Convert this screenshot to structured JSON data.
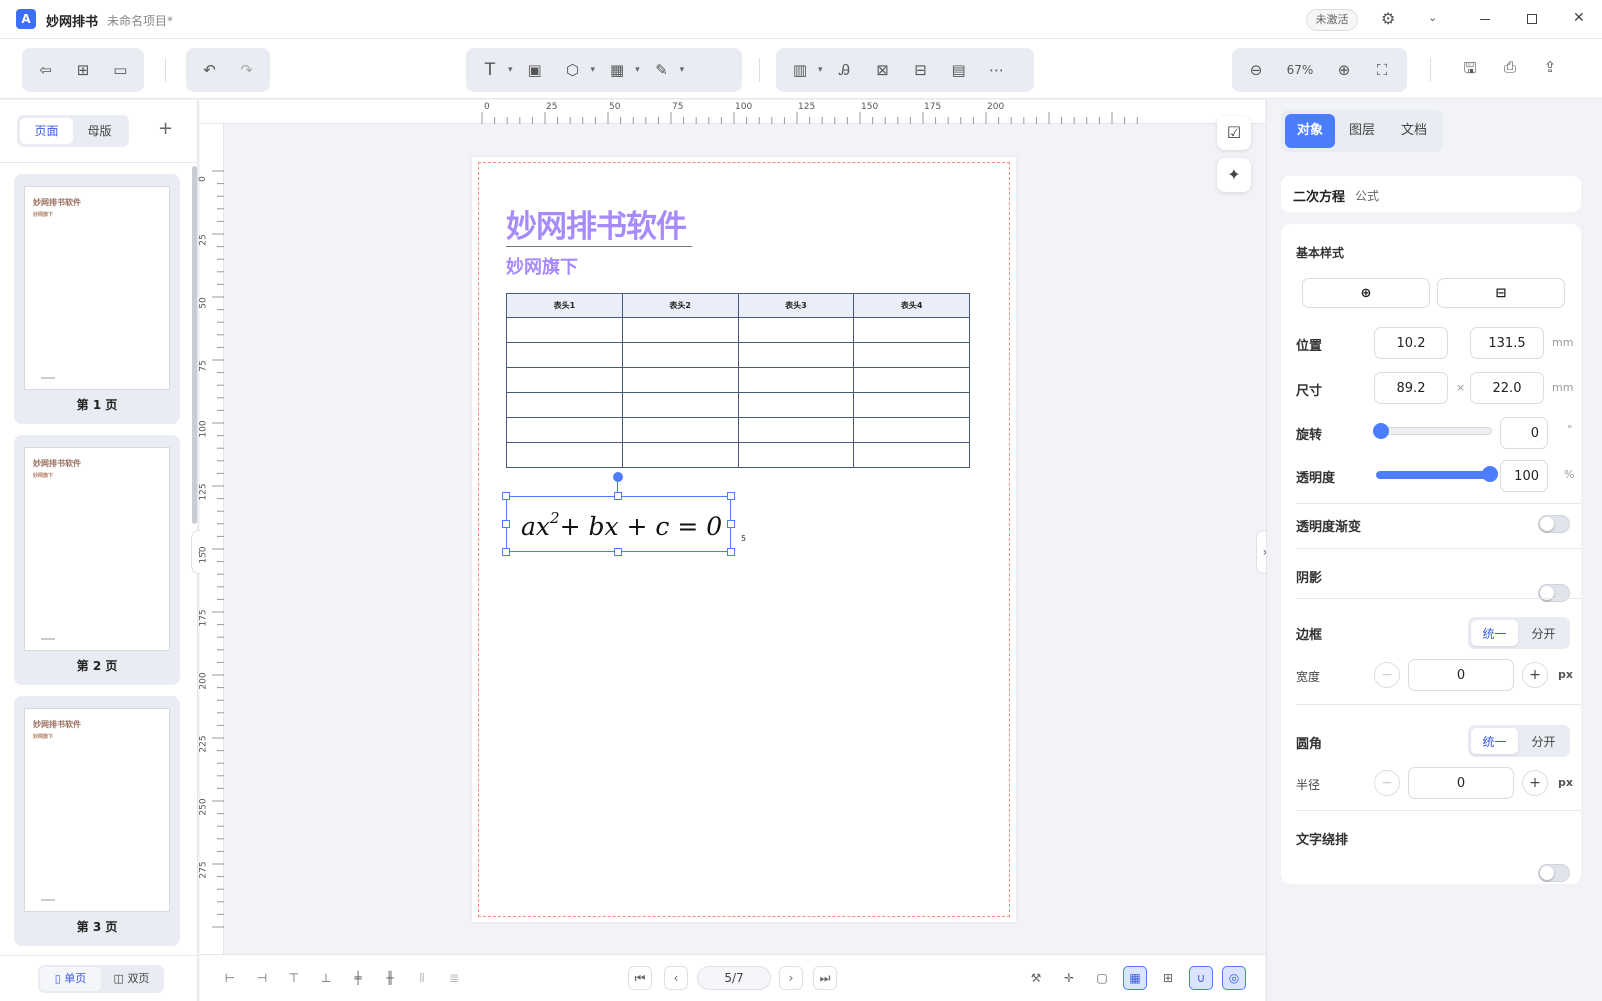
{
  "app": {
    "name": "妙网排书",
    "project": "未命名项目*",
    "activate": "未激活",
    "logo_text": "A"
  },
  "toolbar": {
    "zoom": "67%"
  },
  "sidebar": {
    "tabs": [
      "页面",
      "母版"
    ],
    "pages": [
      {
        "caption": "第 1 页",
        "title": "妙网排书软件",
        "subtitle": "妙网旗下"
      },
      {
        "caption": "第 2 页",
        "title": "妙网排书软件",
        "subtitle": "妙网旗下"
      },
      {
        "caption": "第 3 页",
        "title": "妙网排书软件",
        "subtitle": "妙网旗下"
      }
    ],
    "view_single": "单页",
    "view_double": "双页"
  },
  "ruler": {
    "h": [
      "0",
      "25",
      "50",
      "75",
      "100",
      "125",
      "150",
      "175",
      "200"
    ],
    "v": [
      "0",
      "25",
      "50",
      "75",
      "100",
      "125",
      "150",
      "175",
      "200",
      "225",
      "250",
      "275"
    ]
  },
  "document": {
    "title": "妙网排书软件",
    "subtitle": "妙网旗下",
    "table_headers": [
      "表头1",
      "表头2",
      "表头3",
      "表头4"
    ],
    "equation": {
      "a": "ax",
      "sup": "2",
      "rest": "+ bx + c = 0"
    },
    "marker": "5"
  },
  "pager": {
    "current": "5/7"
  },
  "panel": {
    "tabs": [
      "对象",
      "图层",
      "文档"
    ],
    "object_name": "二次方程",
    "object_type": "公式",
    "basic_style": "基本样式",
    "position_label": "位置",
    "pos_x": "10.2",
    "pos_y": "131.5",
    "size_label": "尺寸",
    "size_w": "89.2",
    "size_h": "22.0",
    "times": "×",
    "unit_mm": "mm",
    "rotation_label": "旋转",
    "rotation": "0",
    "deg": "°",
    "opacity_label": "透明度",
    "opacity": "100",
    "percent": "%",
    "opacity_gradient": "透明度渐变",
    "shadow": "阴影",
    "border": "边框",
    "unified": "统一",
    "separate": "分开",
    "width_label": "宽度",
    "border_width": "0",
    "unit_px": "px",
    "radius_section": "圆角",
    "radius_label": "半径",
    "radius": "0",
    "text_wrap": "文字绕排",
    "minus": "−",
    "plus": "+"
  },
  "colors": {
    "accent": "#4c7dff",
    "purple": "#a78bfa",
    "guide": "#f08a8a"
  }
}
